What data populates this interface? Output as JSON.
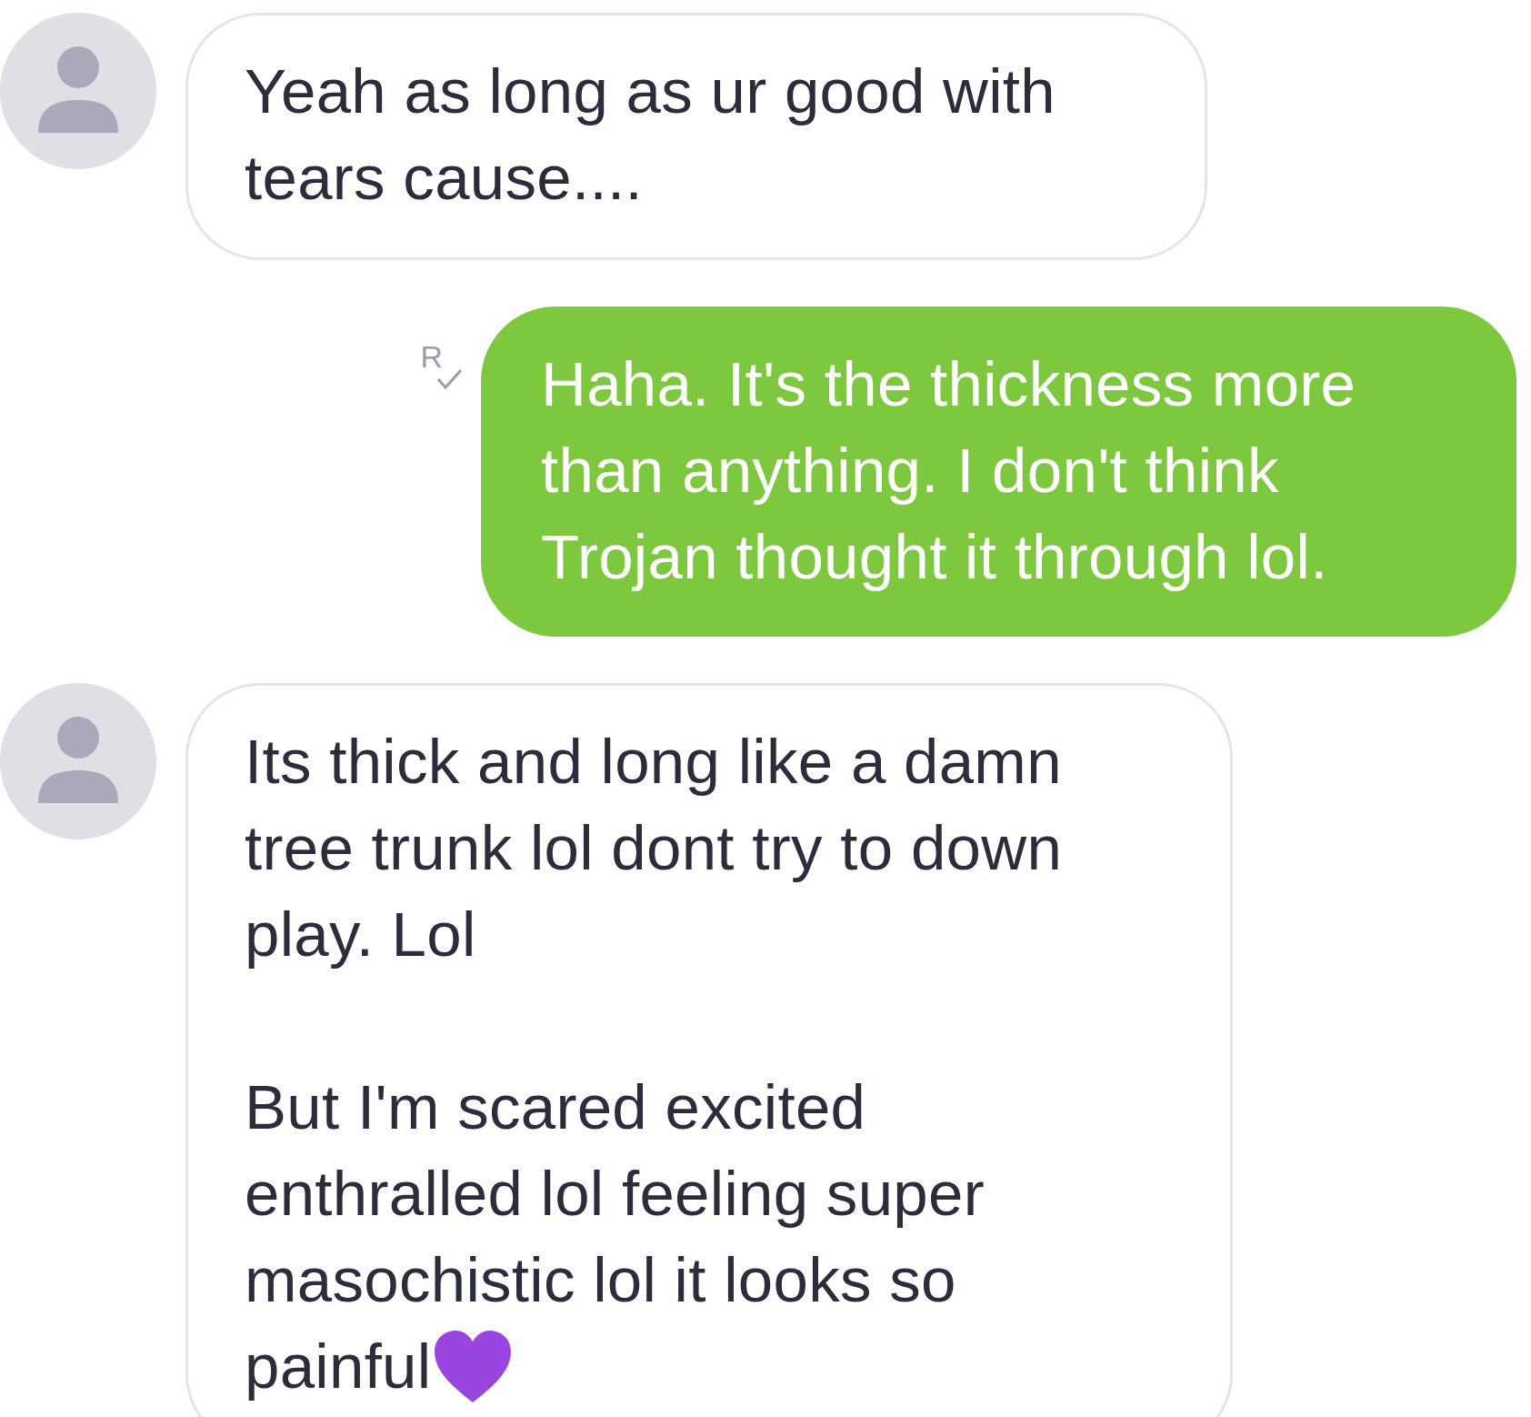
{
  "messages": [
    {
      "kind": "incoming",
      "paragraphs": [
        "Yeah as long as ur good with tears cause...."
      ]
    },
    {
      "kind": "outgoing",
      "receipt": "R",
      "paragraphs": [
        "Haha. It's the thickness more than anything. I don't think Trojan thought it through lol."
      ]
    },
    {
      "kind": "incoming",
      "paragraphs": [
        "Its thick and long like a damn tree trunk lol dont try to down play. Lol",
        "But I'm scared excited enthralled lol feeling super masochistic lol it looks so painful"
      ],
      "ends_with_heart": true
    }
  ]
}
